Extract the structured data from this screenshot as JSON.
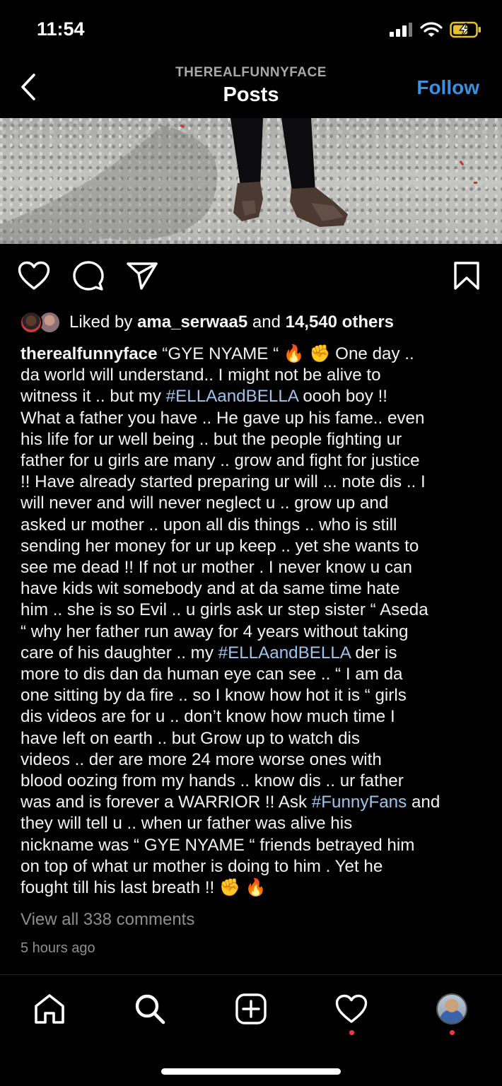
{
  "status_bar": {
    "time": "11:54"
  },
  "header": {
    "username": "THEREALFUNNYFACE",
    "title": "Posts",
    "follow_label": "Follow"
  },
  "likes": {
    "prefix": "Liked by ",
    "liker": "ama_serwaa5",
    "middle": " and ",
    "count_text": "14,540 others"
  },
  "caption": {
    "username": "therealfunnyface",
    "lines": [
      "“GYE  NYAME “",
      " One day ..",
      "da world will understand.. I might not be alive to",
      "witness it .. but my ",
      "#ELLAandBELLA",
      "  oooh boy !!",
      "What a father you have .. He gave up his fame.. even",
      "his life for ur well being .. but the people fighting ur",
      "father for u girls are many .. grow and fight for justice",
      "!! Have already started preparing ur will ... note dis .. I",
      "will never and will never neglect u .. grow up and",
      "asked ur mother .. upon all dis things .. who is still",
      "sending her money for ur up keep .. yet she wants to",
      "see me dead !! If not ur mother . I never know u can",
      "have kids wit somebody and at da same time hate",
      "him .. she is so Evil .. u girls ask ur step sister “ Aseda",
      "“ why her father run away for 4 years without taking",
      "care of his daughter .. my ",
      "#ELLAandBELLA",
      "  der is",
      "more to dis dan da human eye can see .. “ I am da",
      "one sitting by da fire .. so I know how hot it is “ girls",
      "dis videos are for u .. don’t know how much time I",
      "have left on earth .. but Grow up to watch dis",
      "videos .. der are more 24 more worse ones with",
      "blood oozing from my hands .. know dis .. ur father",
      "was and is forever a WARRIOR !! Ask ",
      "#FunnyFans",
      " and",
      "they will tell u .. when ur father was alive his",
      "nickname was “ GYE NYAME “ friends betrayed him",
      "on top of what ur mother is doing to him . Yet he",
      "fought till his last breath !! "
    ]
  },
  "comments_link": "View all 338 comments",
  "time_ago": "5 hours ago",
  "icons": {
    "back": "chevron-left-icon",
    "like": "heart-icon",
    "comment": "comment-bubble-icon",
    "share": "paper-plane-icon",
    "save": "bookmark-icon",
    "home": "home-icon",
    "search": "search-icon",
    "create": "plus-square-icon",
    "activity": "heart-icon",
    "profile": "avatar"
  },
  "colors": {
    "background": "#000000",
    "accent": "#3d8fe0",
    "hashtag": "#9fc4ee",
    "muted": "#8e8e8e",
    "notification": "#ff3040"
  }
}
